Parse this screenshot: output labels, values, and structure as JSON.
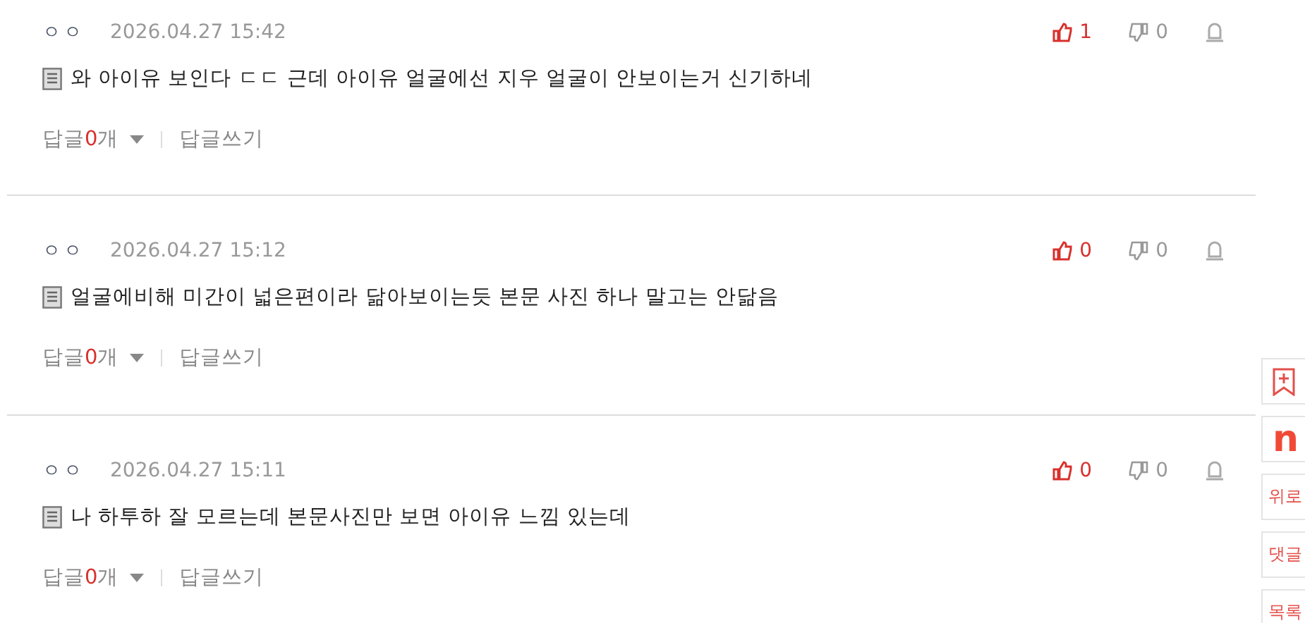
{
  "comments": [
    {
      "author": "ㅇㅇ",
      "date": "2026.04.27 15:42",
      "upvotes": "1",
      "downvotes": "0",
      "upvoted": true,
      "text": "와 아이유 보인다 ㄷㄷ 근데 아이유 얼굴에선 지우 얼굴이 안보이는거 신기하네",
      "reply_label": "답글",
      "reply_count": "0",
      "reply_unit": "개",
      "write_reply": "답글쓰기"
    },
    {
      "author": "ㅇㅇ",
      "date": "2026.04.27 15:12",
      "upvotes": "0",
      "downvotes": "0",
      "upvoted": true,
      "text": "얼굴에비해 미간이 넓은편이라 닮아보이는듯 본문 사진 하나 말고는 안닮음",
      "reply_label": "답글",
      "reply_count": "0",
      "reply_unit": "개",
      "write_reply": "답글쓰기"
    },
    {
      "author": "ㅇㅇ",
      "date": "2026.04.27 15:11",
      "upvotes": "0",
      "downvotes": "0",
      "upvoted": true,
      "text": "나 하투하 잘 모르는데 본문사진만 보면 아이유 느낌 있는데",
      "reply_label": "답글",
      "reply_count": "0",
      "reply_unit": "개",
      "write_reply": "답글쓰기"
    }
  ],
  "side_rail": [
    {
      "kind": "bookmark"
    },
    {
      "kind": "logo",
      "label": "n"
    },
    {
      "kind": "text",
      "label": "위로"
    },
    {
      "kind": "text",
      "label": "댓글"
    },
    {
      "kind": "text",
      "label": "목록"
    }
  ]
}
